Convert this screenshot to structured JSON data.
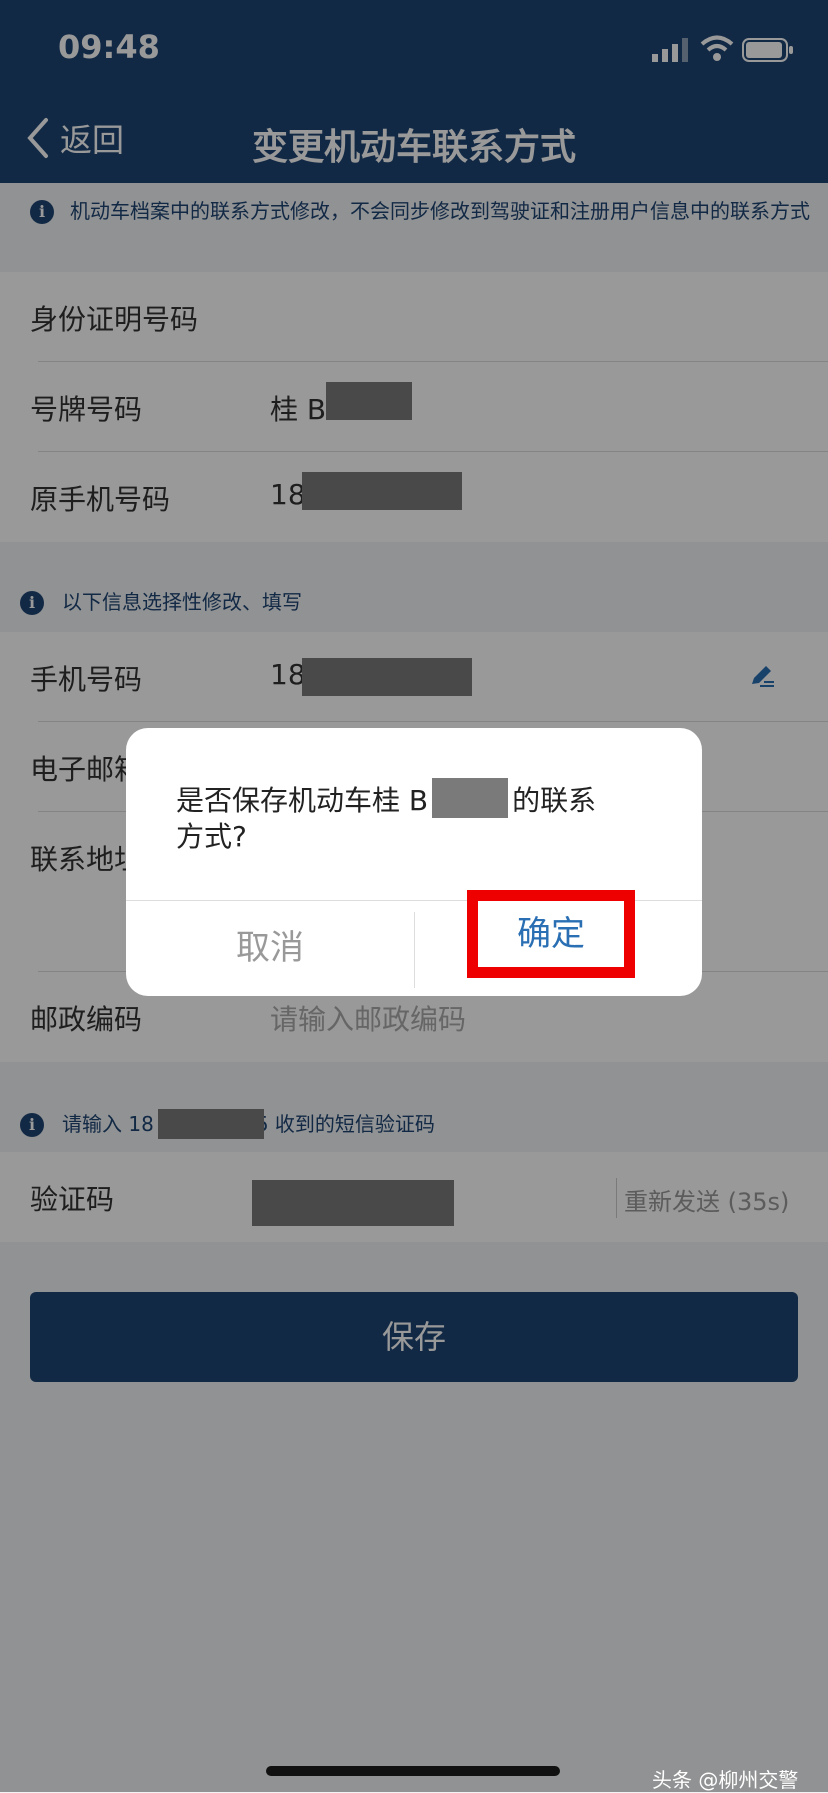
{
  "status_bar": {
    "time": "09:48"
  },
  "nav": {
    "back_label": "返回",
    "title": "变更机动车联系方式"
  },
  "notice1": {
    "text": "机动车档案中的联系方式修改，不会同步修改到驾驶证和注册用户信息中的联系方式"
  },
  "section1": {
    "rows": [
      {
        "label": "身份证明号码",
        "value": ""
      },
      {
        "label": "号牌号码",
        "value": "桂 B"
      },
      {
        "label": "原手机号码",
        "value": "18"
      }
    ]
  },
  "notice2": {
    "text": "以下信息选择性修改、填写"
  },
  "section2": {
    "rows": [
      {
        "label": "手机号码",
        "value": "18"
      },
      {
        "label": "电子邮箱",
        "value": ""
      },
      {
        "label": "联系地址",
        "value": ""
      },
      {
        "label": "邮政编码",
        "placeholder": "请输入邮政编码"
      }
    ]
  },
  "notice3": {
    "prefix": "请输入 18",
    "suffix": "5 收到的短信验证码"
  },
  "verify": {
    "label": "验证码",
    "resend": "重新发送 (35s)"
  },
  "save_button": "保存",
  "dialog": {
    "message_prefix": "是否保存机动车桂 B",
    "message_suffix": "的联系",
    "message_line2": "方式?",
    "cancel": "取消",
    "confirm": "确定"
  },
  "watermark": "头条 @柳州交警",
  "colors": {
    "brand": "#1e4574",
    "link": "#2a6fb3",
    "highlight": "#ee0000"
  }
}
